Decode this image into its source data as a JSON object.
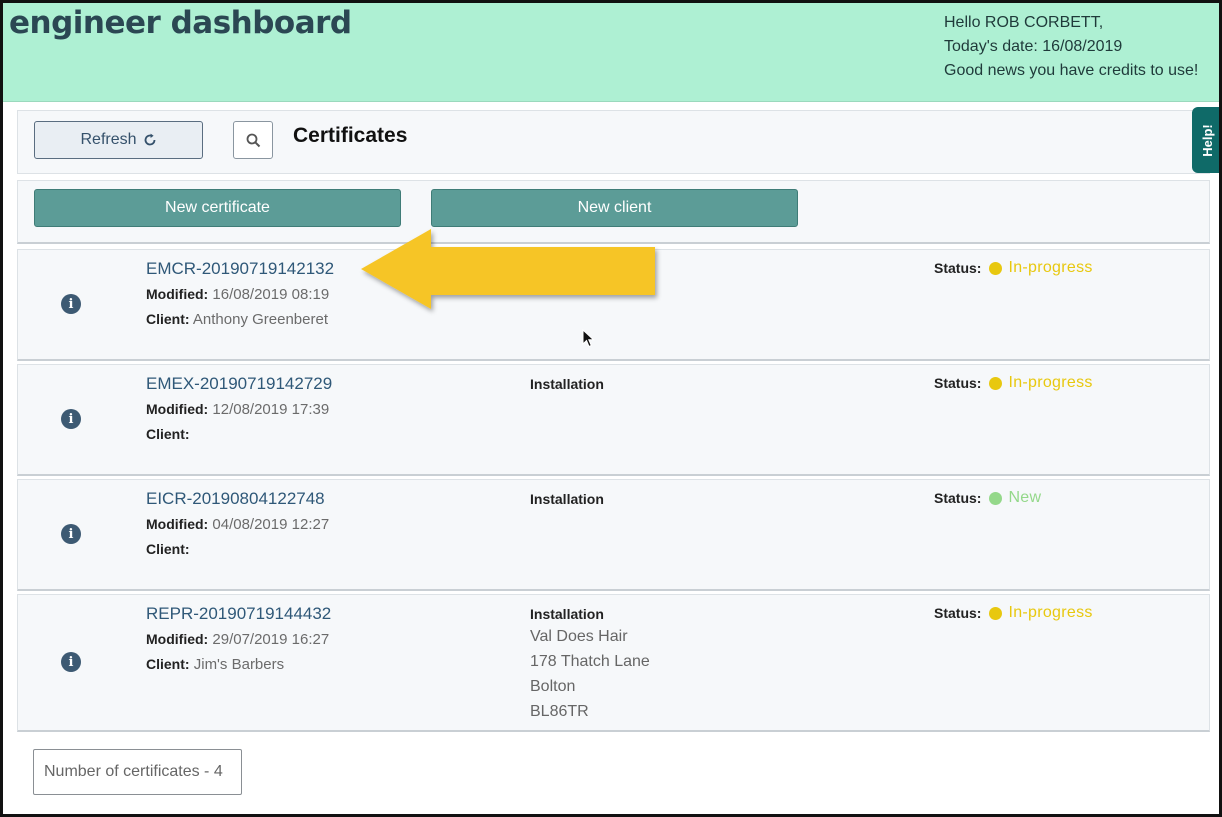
{
  "header": {
    "brand": "engineer dashboard",
    "greeting": "Hello ROB CORBETT,",
    "date_line": "Today's date: 16/08/2019",
    "credits_line": "Good news you have credits to use!"
  },
  "help_tab": {
    "label": "Help!"
  },
  "toolbar": {
    "refresh_label": "Refresh",
    "refresh_icon": "refresh-icon",
    "search_icon": "search-icon",
    "title": "Certificates"
  },
  "actions": {
    "new_certificate": "New certificate",
    "new_client": "New client"
  },
  "labels": {
    "modified": "Modified:",
    "client": "Client:",
    "status": "Status:"
  },
  "status_colors": {
    "In-progress": "#e8c80f",
    "New": "#94d88a"
  },
  "certificates": [
    {
      "ref": "EMCR-20190719142132",
      "modified": "16/08/2019 08:19",
      "client": "Anthony Greenberet",
      "type": "",
      "address": [],
      "status": "In-progress"
    },
    {
      "ref": "EMEX-20190719142729",
      "modified": "12/08/2019 17:39",
      "client": "",
      "type": "Installation",
      "address": [],
      "status": "In-progress"
    },
    {
      "ref": "EICR-20190804122748",
      "modified": "04/08/2019 12:27",
      "client": "",
      "type": "Installation",
      "address": [],
      "status": "New"
    },
    {
      "ref": "REPR-20190719144432",
      "modified": "29/07/2019 16:27",
      "client": "Jim's Barbers",
      "type": "Installation",
      "address": [
        "Val Does Hair",
        "178 Thatch Lane",
        "Bolton",
        "BL86TR"
      ],
      "status": "In-progress"
    }
  ],
  "footer": {
    "count_text": "Number of certificates - 4"
  }
}
